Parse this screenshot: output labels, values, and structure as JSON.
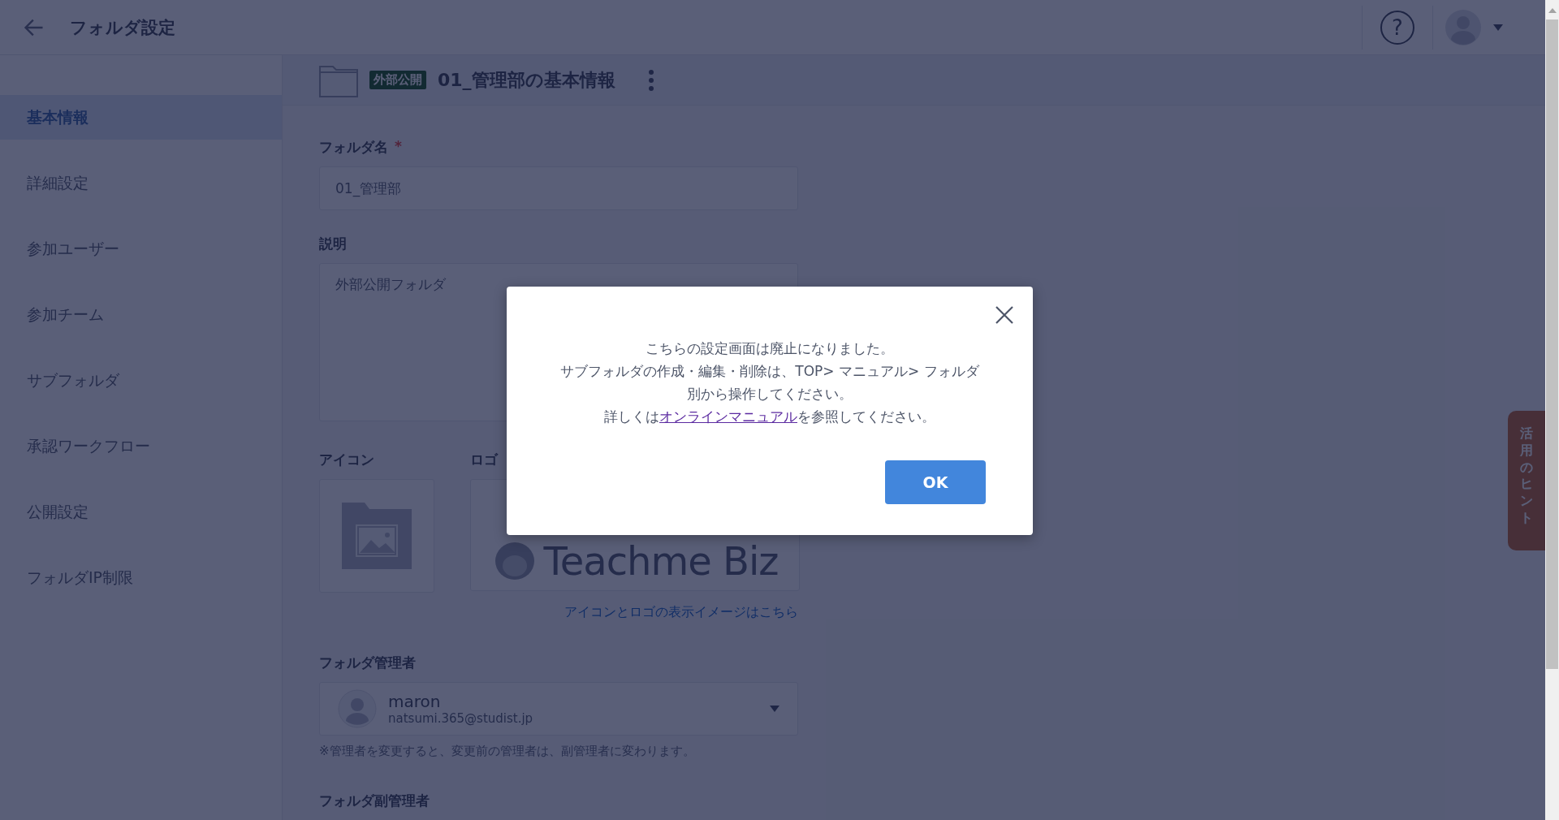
{
  "header": {
    "title": "フォルダ設定",
    "help": "?"
  },
  "sidebar": {
    "items": [
      {
        "label": "基本情報",
        "selected": true
      },
      {
        "label": "詳細設定",
        "selected": false
      },
      {
        "label": "参加ユーザー",
        "selected": false
      },
      {
        "label": "参加チーム",
        "selected": false
      },
      {
        "label": "サブフォルダ",
        "selected": false
      },
      {
        "label": "承認ワークフロー",
        "selected": false
      },
      {
        "label": "公開設定",
        "selected": false
      },
      {
        "label": "フォルダIP制限",
        "selected": false
      }
    ]
  },
  "folder": {
    "badge": "外部公開",
    "title": "01_管理部の基本情報"
  },
  "form": {
    "name_label": "フォルダ名",
    "required_mark": "*",
    "name_value": "01_管理部",
    "description_label": "説明",
    "description_value": "外部公開フォルダ",
    "icon_label": "アイコン",
    "logo_label": "ロゴ",
    "logo_text": "Teachme Biz",
    "preview_link": "アイコンとロゴの表示イメージはこちら",
    "admin_label": "フォルダ管理者",
    "admin_name": "maron",
    "admin_email": "natsumi.365@studist.jp",
    "admin_note": "※管理者を変更すると、変更前の管理者は、副管理者に変わります。",
    "subadmin_label": "フォルダ副管理者"
  },
  "hint_tab": "活用のヒント",
  "dialog": {
    "lines": [
      "こちらの設定画面は廃止になりました。",
      "サブフォルダの作成・編集・削除は、TOP> マニュアル> フォルダ別から操作してください。"
    ],
    "link_before": "詳しくは",
    "link": "オンラインマニュアル",
    "link_after": "を参照してください。",
    "ok": "OK"
  }
}
